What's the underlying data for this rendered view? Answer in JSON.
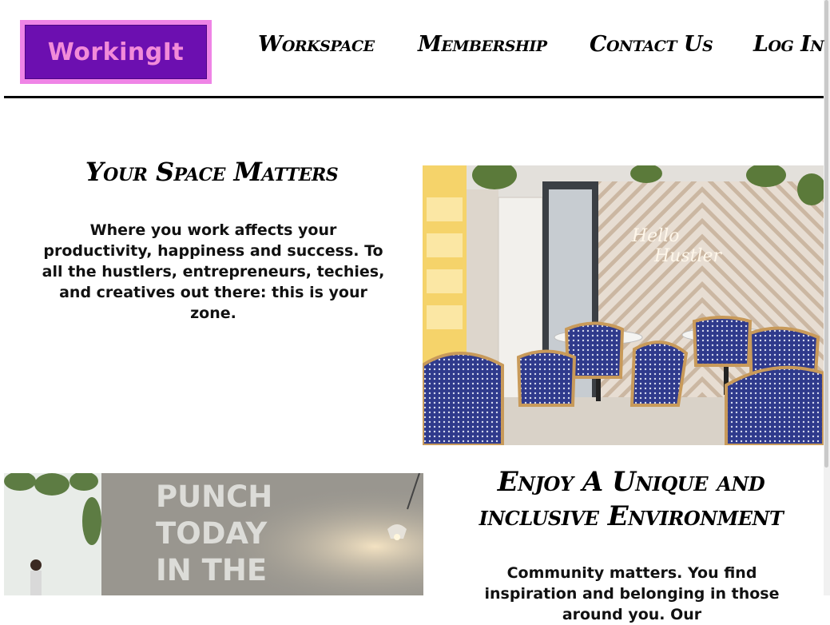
{
  "header": {
    "logo_text": "WorkingIt",
    "nav": [
      "Workspace",
      "Membership",
      "Contact Us",
      "Log In"
    ]
  },
  "section1": {
    "title": "Your Space Matters",
    "text": "Where you work affects your productivity, happiness and success. To all the hustlers, entrepreneurs, techies, and creatives out there: this is your zone.",
    "image_sign": [
      "Hello",
      "Hustler"
    ]
  },
  "section2": {
    "title": "Enjoy A Unique and inclusive Environment",
    "text": "Community matters. You find inspiration and belonging in those around you. Our",
    "image_wall": [
      "PUNCH",
      "TODAY",
      "IN THE"
    ]
  },
  "colors": {
    "logo_outer": "#ef84e6",
    "logo_inner": "#6c0fb0",
    "logo_text": "#f28bd9"
  }
}
